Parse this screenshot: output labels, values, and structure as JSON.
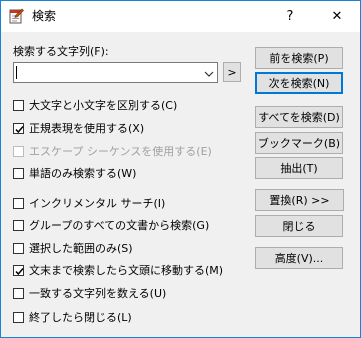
{
  "window": {
    "title": "検索",
    "help_label": "?",
    "close_label": "✕"
  },
  "search": {
    "label": "検索する文字列(F):",
    "value": "",
    "expand_label": ">"
  },
  "options": [
    {
      "label": "大文字と小文字を区別する(C)",
      "checked": false,
      "enabled": true
    },
    {
      "label": "正規表現を使用する(X)",
      "checked": true,
      "enabled": true
    },
    {
      "label": "エスケープ シーケンスを使用する(E)",
      "checked": false,
      "enabled": false
    },
    {
      "label": "単語のみ検索する(W)",
      "checked": false,
      "enabled": true
    },
    {
      "label": "インクリメンタル サーチ(I)",
      "checked": false,
      "enabled": true
    },
    {
      "label": "グループのすべての文書から検索(G)",
      "checked": false,
      "enabled": true
    },
    {
      "label": "選択した範囲のみ(S)",
      "checked": false,
      "enabled": true
    },
    {
      "label": "文末まで検索したら文頭に移動する(M)",
      "checked": true,
      "enabled": true
    },
    {
      "label": "一致する文字列を数える(U)",
      "checked": false,
      "enabled": true
    },
    {
      "label": "終了したら閉じる(L)",
      "checked": false,
      "enabled": true
    }
  ],
  "buttons": {
    "find_prev": "前を検索(P)",
    "find_next": "次を検索(N)",
    "find_all": "すべてを検索(D)",
    "bookmark": "ブックマーク(B)",
    "extract": "抽出(T)",
    "replace": "置換(R) >>",
    "close": "閉じる",
    "advanced": "高度(V)..."
  }
}
